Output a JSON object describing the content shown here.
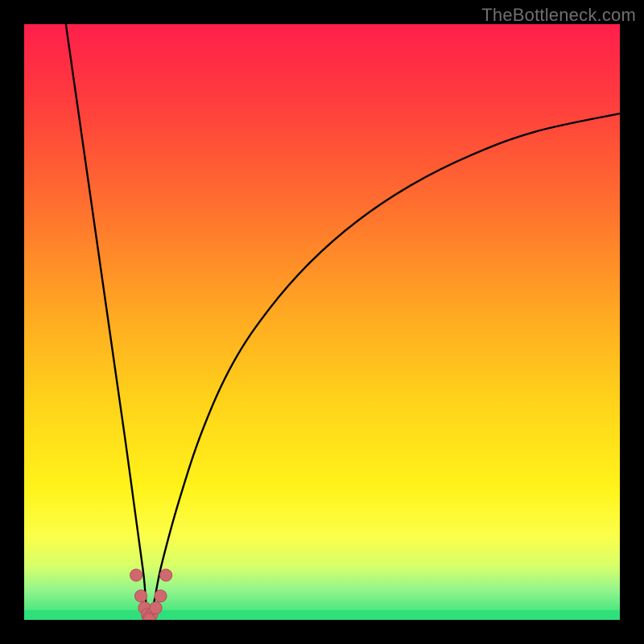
{
  "watermark": "TheBottleneck.com",
  "colors": {
    "frame": "#000000",
    "gradient_stops": [
      {
        "offset": 0.0,
        "color": "#ff1f4b"
      },
      {
        "offset": 0.12,
        "color": "#ff3a3e"
      },
      {
        "offset": 0.3,
        "color": "#ff6e2f"
      },
      {
        "offset": 0.48,
        "color": "#ffa722"
      },
      {
        "offset": 0.63,
        "color": "#ffd21a"
      },
      {
        "offset": 0.78,
        "color": "#fff31a"
      },
      {
        "offset": 0.86,
        "color": "#fbff4a"
      },
      {
        "offset": 0.91,
        "color": "#d7ff6a"
      },
      {
        "offset": 0.95,
        "color": "#93f58c"
      },
      {
        "offset": 1.0,
        "color": "#2fe07a"
      }
    ],
    "curve": "#000000",
    "markers_fill": "#cf6970",
    "markers_stroke": "#b94f57",
    "green_band": "#2fe07a"
  },
  "chart_data": {
    "type": "line",
    "title": "",
    "xlabel": "",
    "ylabel": "",
    "xlim": [
      0,
      100
    ],
    "ylim": [
      0,
      100
    ],
    "description": "Bottleneck-style V-curve: percentage-like metric (y) vs some hardware ratio (x). Minimum near x≈21 at y≈0; curve rises steeply to y≈100 at x=0 and asymptotically toward y≈85 at x=100. Dotted markers cluster around the minimum.",
    "series": [
      {
        "name": "curve-left",
        "x": [
          7,
          9,
          11,
          13,
          15,
          17,
          18.5,
          20,
          21
        ],
        "y": [
          100,
          86,
          72,
          58,
          44,
          30,
          19,
          8,
          0
        ]
      },
      {
        "name": "curve-right",
        "x": [
          21,
          23,
          26,
          30,
          35,
          41,
          48,
          56,
          65,
          75,
          86,
          100
        ],
        "y": [
          0,
          9,
          20,
          32,
          43,
          52,
          60,
          67,
          73,
          78,
          82,
          85
        ]
      }
    ],
    "markers": {
      "name": "dots",
      "x": [
        18.8,
        19.6,
        20.2,
        20.7,
        21.4,
        22.1,
        22.9,
        23.8,
        20.9,
        21.0
      ],
      "y": [
        7.5,
        4.0,
        2.0,
        0.9,
        0.9,
        2.0,
        4.0,
        7.5,
        0.3,
        0.0
      ]
    }
  }
}
